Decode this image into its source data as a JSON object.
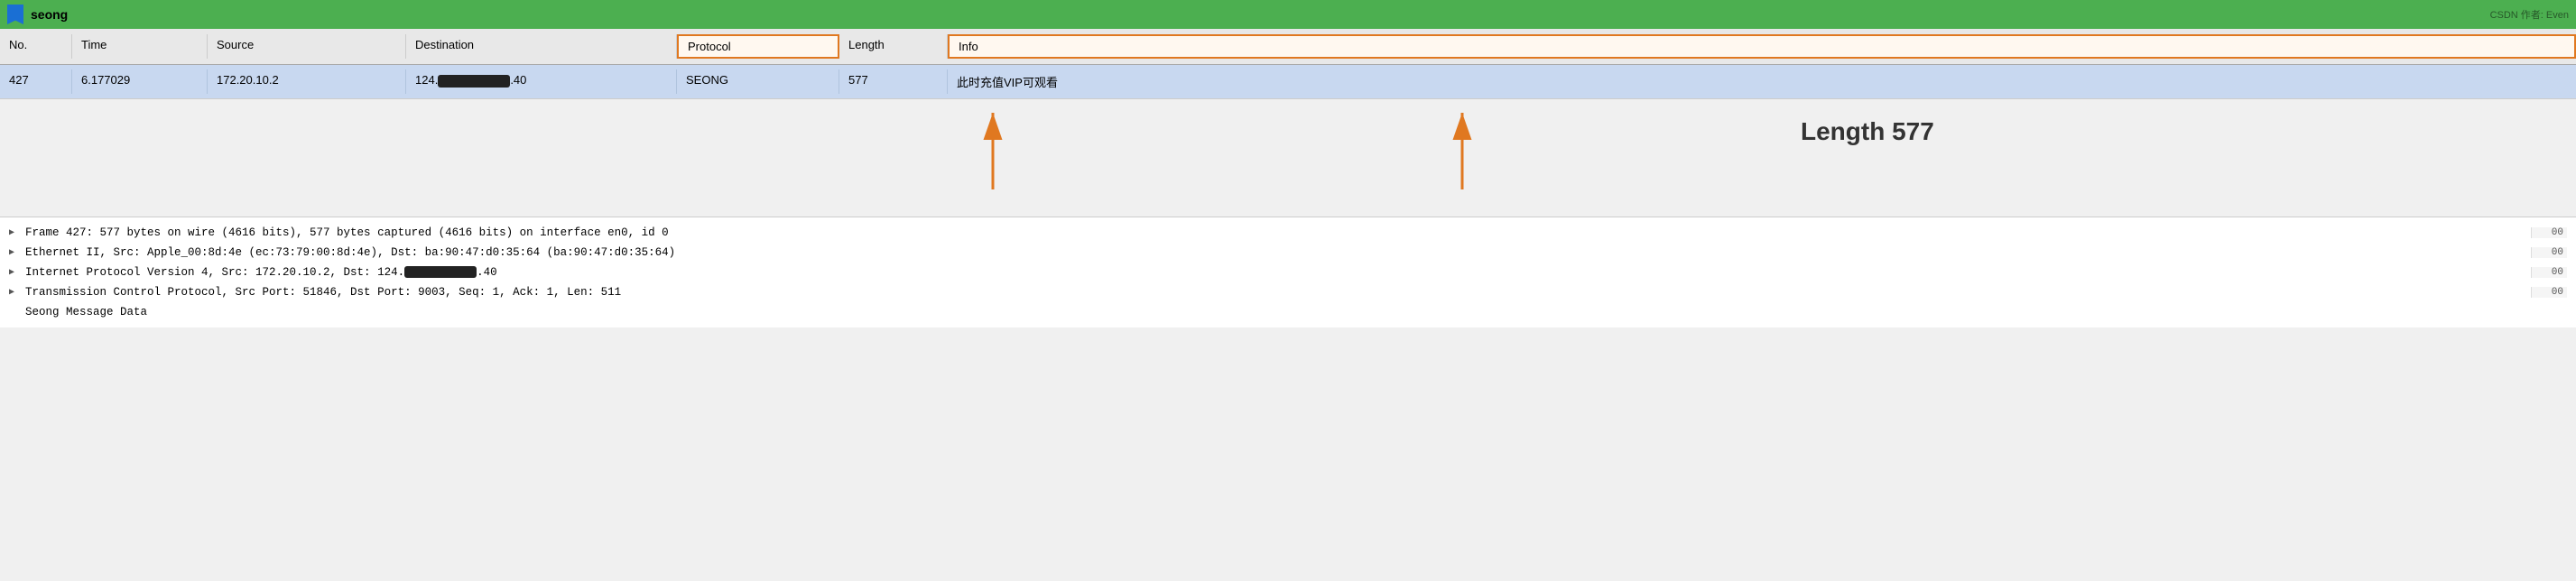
{
  "titleBar": {
    "title": "seong",
    "watermark": "CSDN 作者: Even"
  },
  "tableHeader": {
    "columns": [
      "No.",
      "Time",
      "Source",
      "Destination",
      "Protocol",
      "Length",
      "Info"
    ]
  },
  "tableRow": {
    "no": "427",
    "time": "6.177029",
    "source": "172.20.10.2",
    "dest_prefix": "124.",
    "dest_suffix": ".40",
    "protocol": "SEONG",
    "length": "577",
    "info": "此时充值VIP可观看"
  },
  "lengthAnnotation": "Length 577",
  "arrowColors": {
    "protocol": "#e07820",
    "info": "#e07820"
  },
  "detailRows": [
    {
      "text": "Frame 427: 577 bytes on wire (4616 bits), 577 bytes captured (4616 bits) on interface en0, id 0",
      "hex": "00"
    },
    {
      "text": "Ethernet II, Src: Apple_00:8d:4e (ec:73:79:00:8d:4e), Dst: ba:90:47:d0:35:64 (ba:90:47:d0:35:64)",
      "hex": "00"
    },
    {
      "text": "Internet Protocol Version 4, Src: 172.20.10.2, Dst: 124.█████████.40",
      "hex": "00"
    },
    {
      "text": "Transmission Control Protocol, Src Port: 51846, Dst Port: 9003, Seq: 1, Ack: 1, Len: 511",
      "hex": "00"
    },
    {
      "text": "Seong Message Data",
      "hex": ""
    }
  ]
}
